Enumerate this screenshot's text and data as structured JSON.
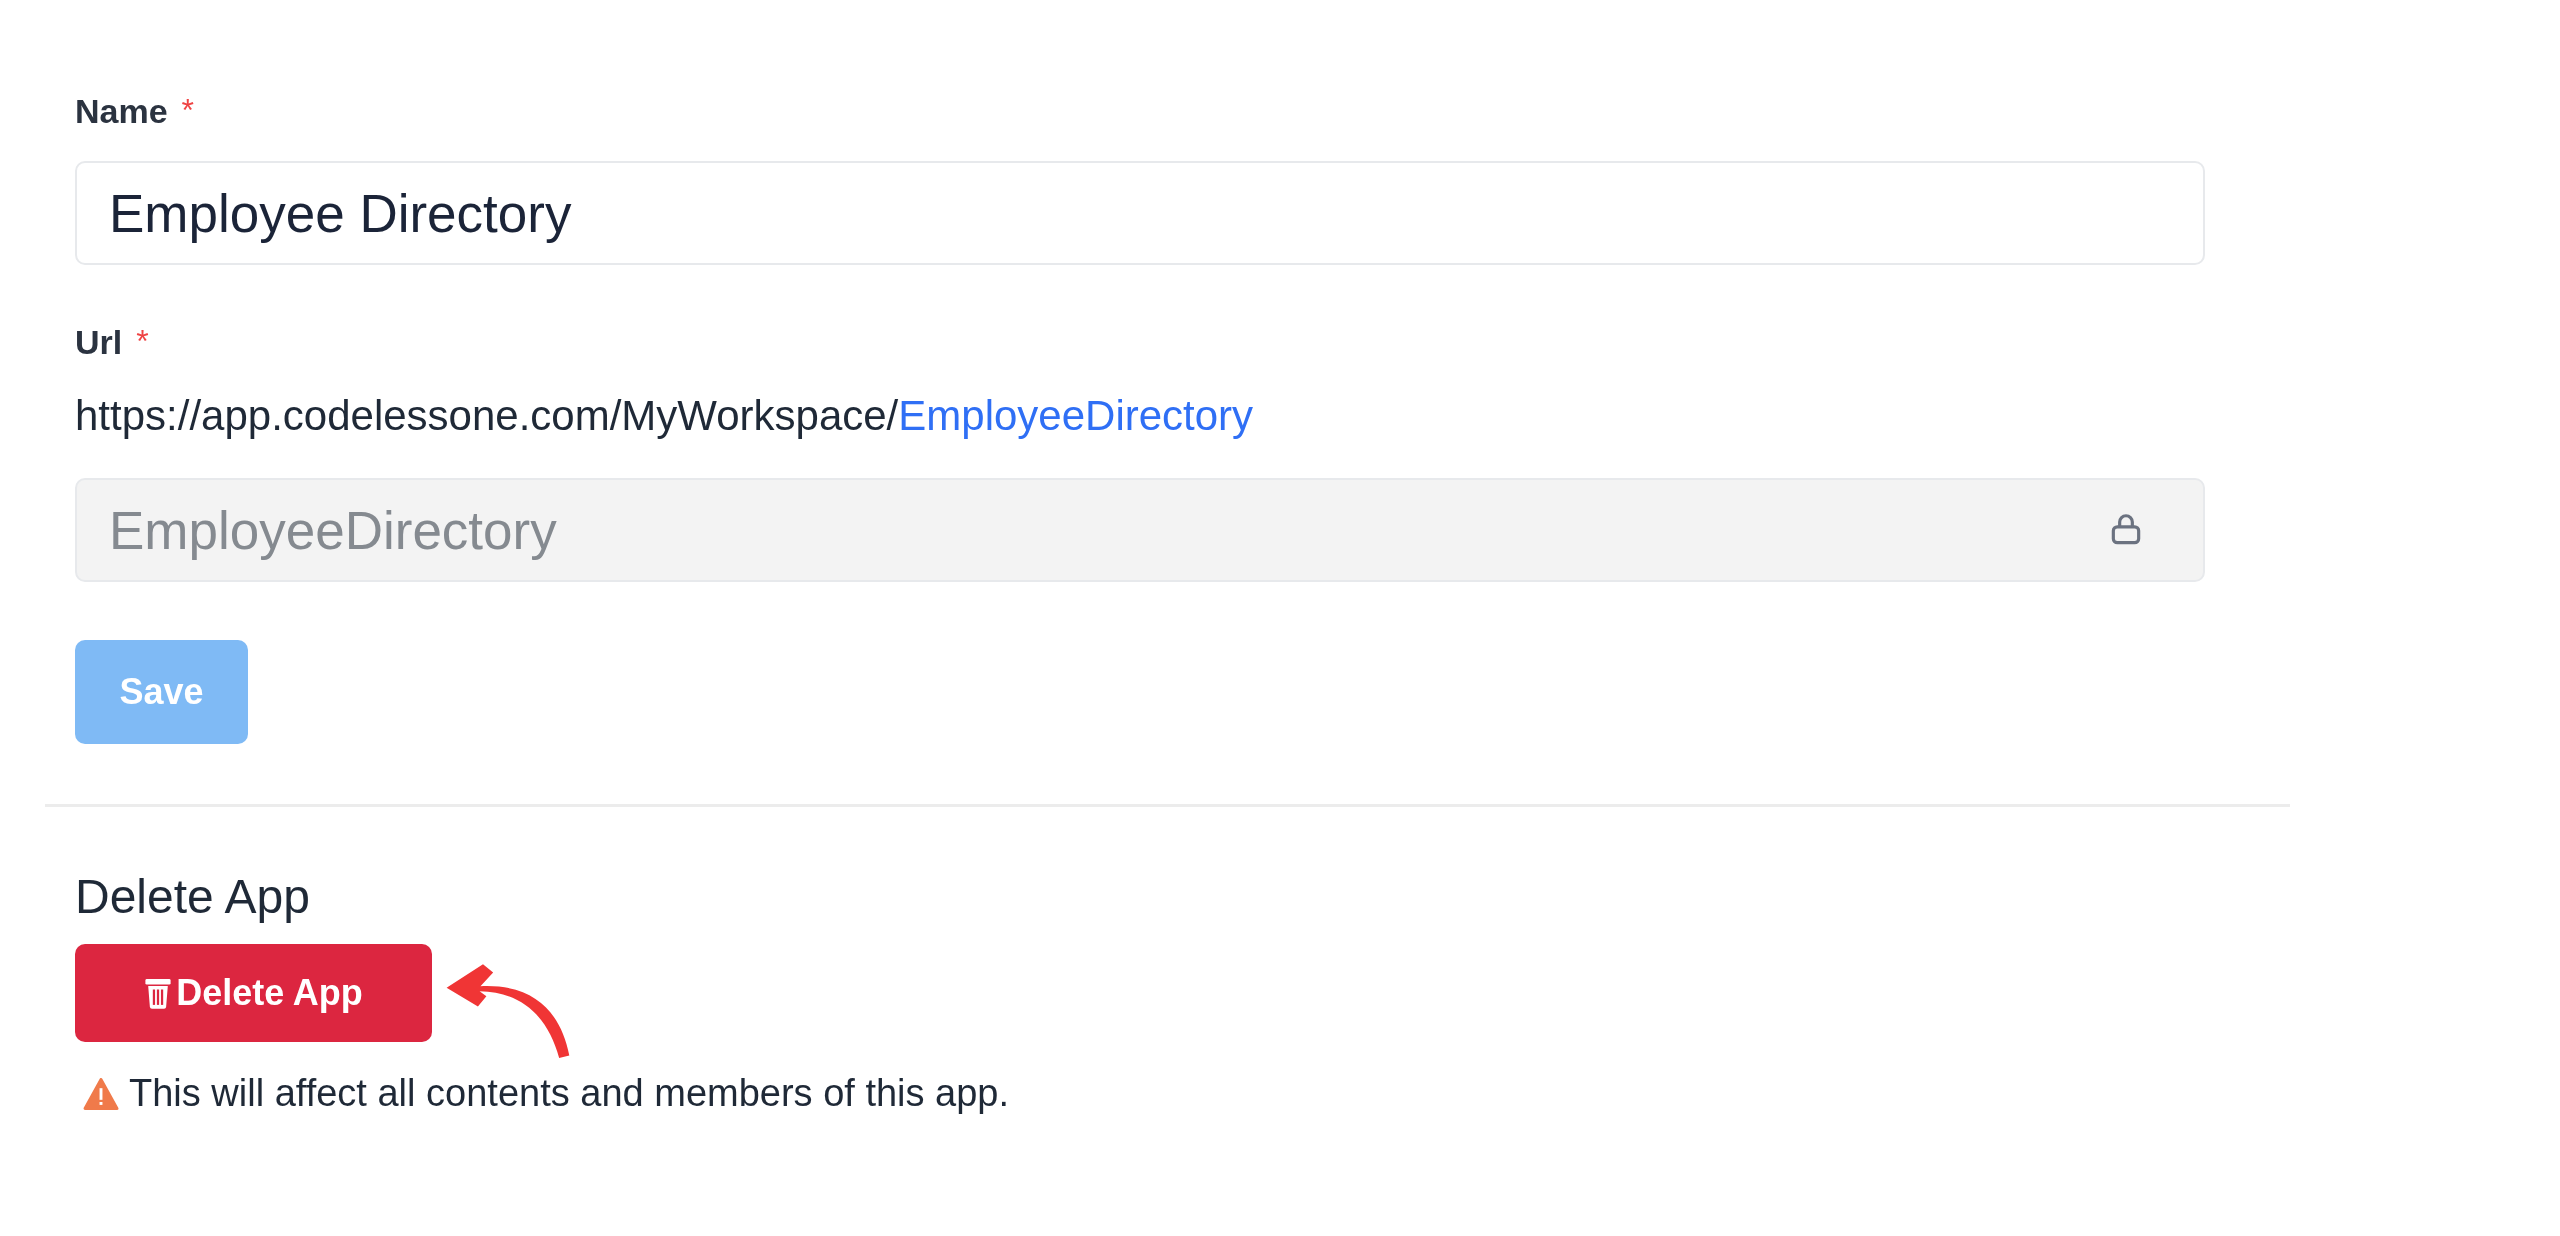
{
  "fields": [
    {
      "label": "Name",
      "required_mark": "*",
      "value": "Employee Directory",
      "locked": false
    },
    {
      "label": "Url",
      "required_mark": "*",
      "url_prefix": "https://app.codelessone.com/MyWorkspace/",
      "url_slug": "EmployeeDirectory",
      "value": "EmployeeDirectory",
      "locked": true
    }
  ],
  "save_button": {
    "label": "Save",
    "disabled": true
  },
  "danger_zone": {
    "heading": "Delete App",
    "button": "Delete App",
    "warning": "This will affect all contents and members of this app."
  }
}
